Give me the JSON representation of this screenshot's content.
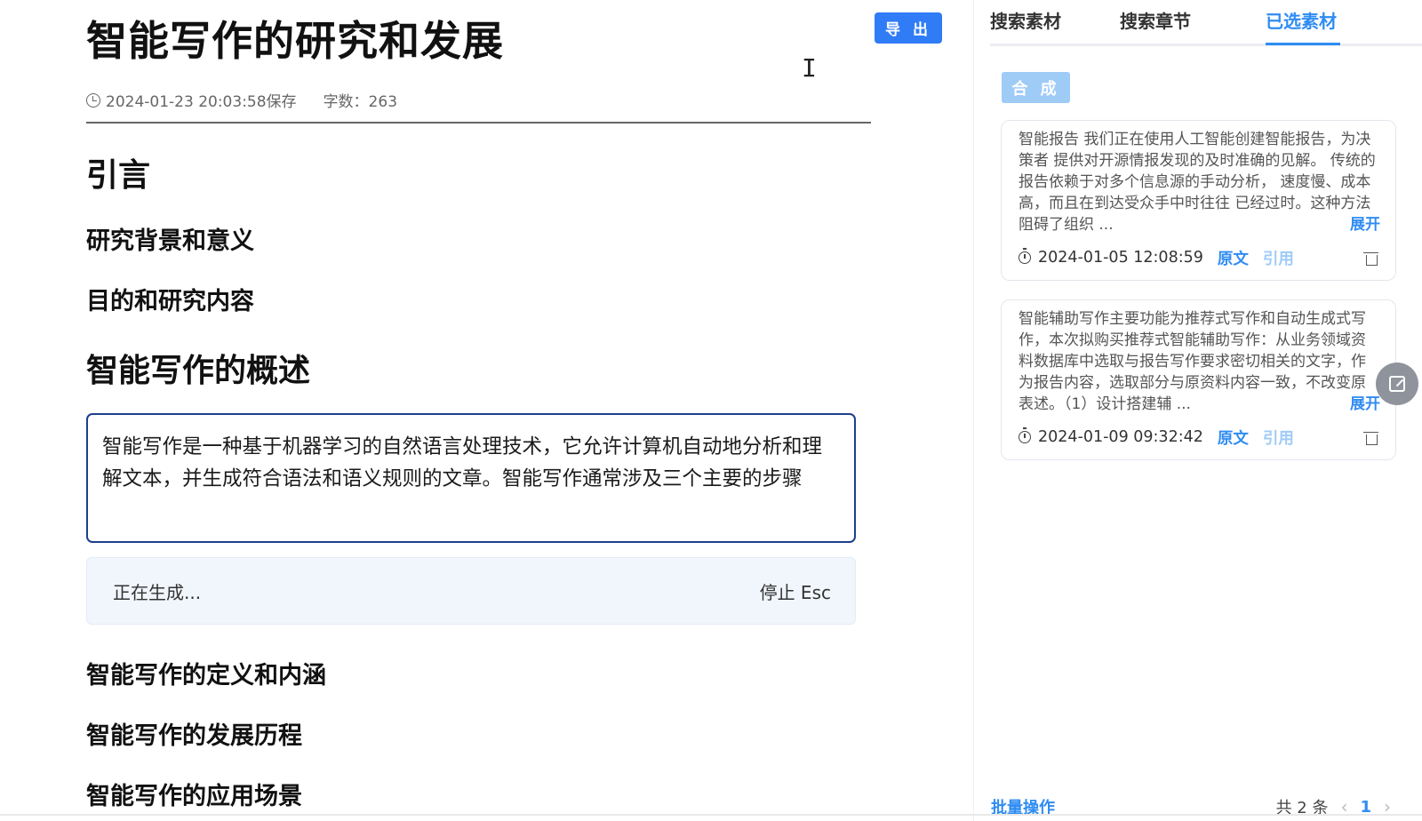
{
  "editor": {
    "title": "智能写作的研究和发展",
    "export_label": "导 出",
    "saved_time": "2024-01-23 20:03:58保存",
    "word_count": "字数：263",
    "outline": [
      {
        "level": 1,
        "text": "引言"
      },
      {
        "level": 2,
        "text": "研究背景和意义"
      },
      {
        "level": 2,
        "text": "目的和研究内容"
      },
      {
        "level": 1,
        "text": "智能写作的概述"
      },
      {
        "level": 2,
        "text": "智能写作的定义和内涵"
      },
      {
        "level": 2,
        "text": "智能写作的发展历程"
      },
      {
        "level": 2,
        "text": "智能写作的应用场景"
      }
    ],
    "generated_text": "智能写作是一种基于机器学习的自然语言处理技术，它允许计算机自动地分析和理解文本，并生成符合语法和语义规则的文章。智能写作通常涉及三个主要的步骤",
    "generating_label": "正在生成...",
    "stop_label": "停止 Esc"
  },
  "panel": {
    "tabs": [
      {
        "label": "搜索素材",
        "active": false
      },
      {
        "label": "搜索章节",
        "active": false
      },
      {
        "label": "已选素材",
        "active": true
      }
    ],
    "merge_label": "合 成",
    "cards": [
      {
        "text": "智能报告 我们正在使用人工智能创建智能报告，为决策者 提供对开源情报发现的及时准确的见解。 传统的报告依赖于对多个信息源的手动分析， 速度慢、成本高，而且在到达受众手中时往往 已经过时。这种方法阻碍了组织 ...",
        "expand": "展开",
        "time": "2024-01-05 12:08:59",
        "source_label": "原文",
        "cite_label": "引用"
      },
      {
        "text": "智能辅助写作主要功能为推荐式写作和自动生成式写作，本次拟购买推荐式智能辅助写作：从业务领域资料数据库中选取与报告写作要求密切相关的文字，作为报告内容，选取部分与原资料内容一致，不改变原表述。（1）设计搭建辅 ...",
        "expand": "展开",
        "time": "2024-01-09 09:32:42",
        "source_label": "原文",
        "cite_label": "引用"
      }
    ],
    "batch_label": "批量操作",
    "total_label": "共 2 条",
    "current_page": "1",
    "prev_glyph": "‹",
    "next_glyph": "›"
  },
  "colors": {
    "accent": "#2f8cf2",
    "accent_light": "#9fcbf7",
    "focus_border": "#1d3f8f",
    "status_bg": "#f1f6fc"
  }
}
